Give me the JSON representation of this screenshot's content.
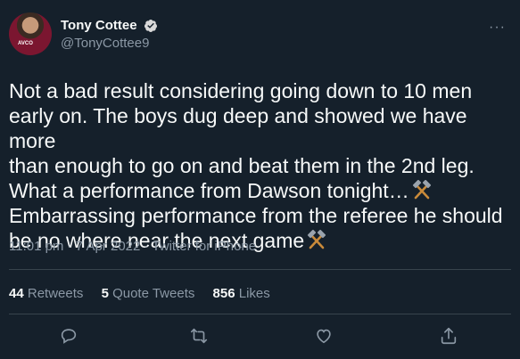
{
  "user": {
    "display_name": "Tony Cottee",
    "handle": "@TonyCottee9",
    "avatar_text": "AVCO",
    "verified_icon": "verified-badge-icon"
  },
  "more_label": "···",
  "tweet": {
    "line1": "Not a bad result considering going down to 10 men",
    "line2": "early on. The boys dug deep and showed we have more",
    "line3": "than enough to go on and beat them in the 2nd leg.",
    "line4": "What a performance from Dawson tonight…",
    "line5": "Embarrassing performance from the referee he should",
    "line6": "be no where near the next game",
    "emoji": "crossed-hammers-icon"
  },
  "meta": {
    "time": "11:01 pm",
    "date": "7 Apr 2022",
    "source": "Twitter for iPhone",
    "sep": " · "
  },
  "stats": {
    "retweets_count": "44",
    "retweets_label": "Retweets",
    "quotes_count": "5",
    "quotes_label": "Quote Tweets",
    "likes_count": "856",
    "likes_label": "Likes"
  },
  "actions": [
    "reply-icon",
    "retweet-icon",
    "like-icon",
    "share-icon"
  ],
  "colors": {
    "background": "#15202b",
    "text": "#f7f9f9",
    "secondary": "#8b98a5",
    "divider": "#38444d",
    "verified": "#1d9bf0"
  }
}
